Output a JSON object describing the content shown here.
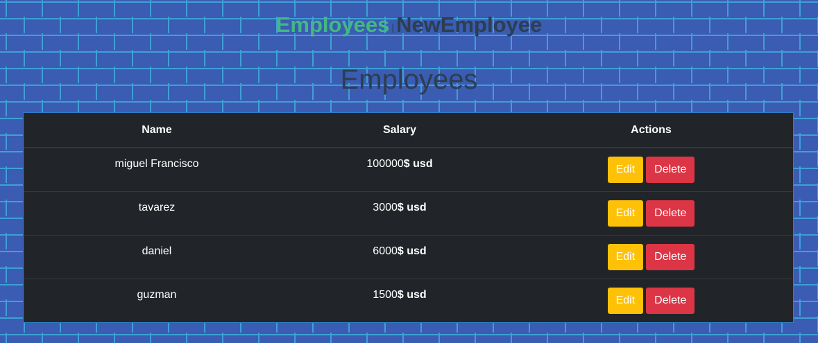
{
  "nav": {
    "links": [
      {
        "label": "Employees",
        "active": true
      },
      {
        "label": "NewEmployee",
        "active": false
      }
    ],
    "separator": "|"
  },
  "page_title": "Employees",
  "colors": {
    "background": "#3a5cb2",
    "brick_lines": "#3fa0d6",
    "active_link": "#42b983",
    "text_dark": "#2c3e50",
    "table_bg": "#212529",
    "edit_button": "#ffc107",
    "delete_button": "#dc3545"
  },
  "table": {
    "headers": {
      "name": "Name",
      "salary": "Salary",
      "actions": "Actions"
    },
    "currency_suffix": "$ usd",
    "rows": [
      {
        "name": "miguel Francisco",
        "salary": "100000",
        "edit_label": "Edit",
        "delete_label": "Delete"
      },
      {
        "name": "tavarez",
        "salary": "3000",
        "edit_label": "Edit",
        "delete_label": "Delete"
      },
      {
        "name": "daniel",
        "salary": "6000",
        "edit_label": "Edit",
        "delete_label": "Delete"
      },
      {
        "name": "guzman",
        "salary": "1500",
        "edit_label": "Edit",
        "delete_label": "Delete"
      }
    ]
  }
}
